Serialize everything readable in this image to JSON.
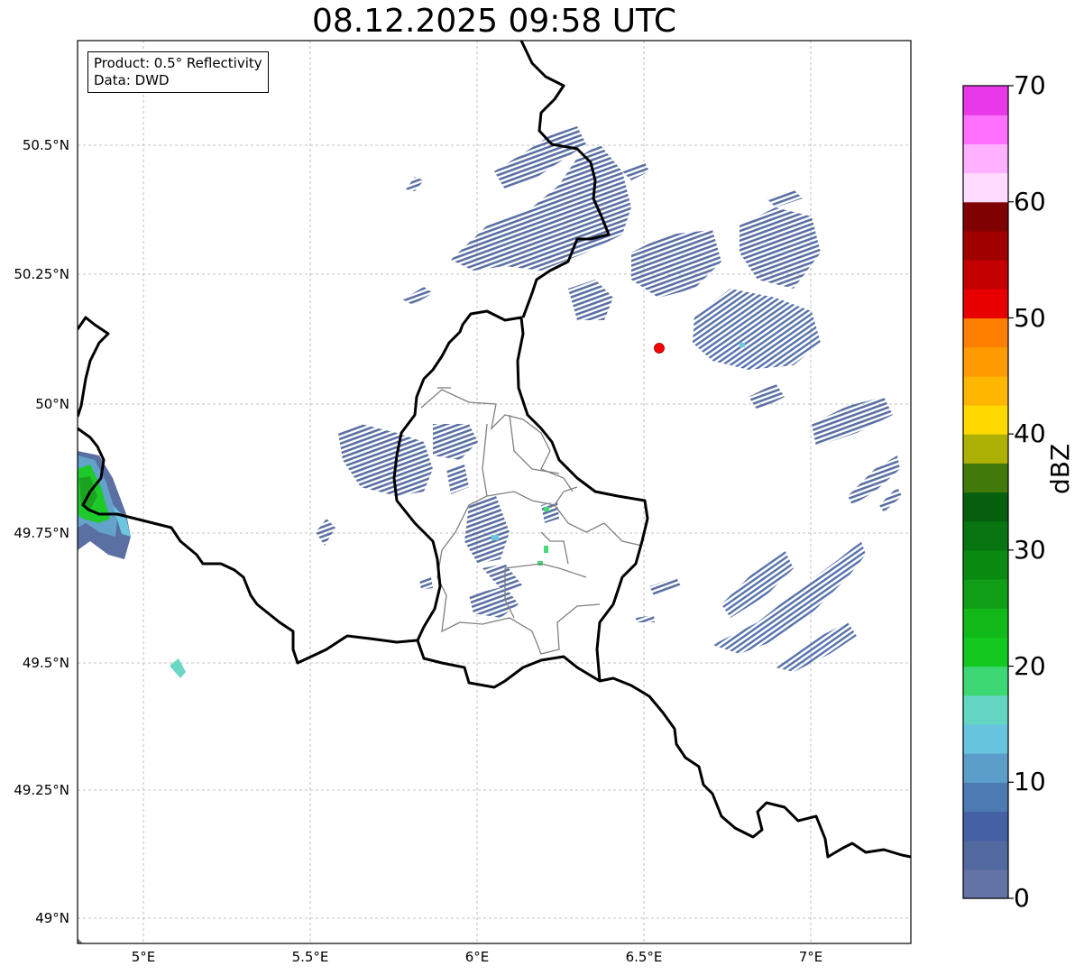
{
  "title": "08.12.2025 09:58 UTC",
  "info": {
    "product": "Product: 0.5° Reflectivity",
    "data": "Data: DWD"
  },
  "map": {
    "lat_labels": [
      "50.5°N",
      "50.25°N",
      "50°N",
      "49.75°N",
      "49.5°N",
      "49.25°N",
      "49°N"
    ],
    "lon_labels": [
      "5°E",
      "5.5°E",
      "6°E",
      "6.5°E",
      "7°E"
    ],
    "lat_values": [
      50.5,
      50.25,
      50.0,
      49.75,
      49.5,
      49.25,
      49.0
    ],
    "lon_values": [
      5.0,
      5.5,
      6.0,
      6.5,
      7.0
    ],
    "extent": {
      "lon_min": 4.8,
      "lon_max": 7.3,
      "lat_min": 48.95,
      "lat_max": 50.7
    },
    "radar_site": {
      "lon": 6.55,
      "lat": 50.11,
      "color": "#ff0000"
    }
  },
  "colorbar": {
    "label": "dBZ",
    "tick_labels": [
      "0",
      "10",
      "20",
      "30",
      "40",
      "50",
      "60",
      "70"
    ],
    "min": 0,
    "max": 70,
    "colors": [
      "#6473a5",
      "#52699f",
      "#4461a6",
      "#4d7ab3",
      "#5a9ec9",
      "#66c4de",
      "#63d6c3",
      "#3dd773",
      "#13c81e",
      "#11b919",
      "#0f9e15",
      "#0b8a12",
      "#077511",
      "#055f0d",
      "#417a0a",
      "#adb103",
      "#ffd800",
      "#ffb600",
      "#ff9a00",
      "#ff7f00",
      "#e80000",
      "#c40000",
      "#a10000",
      "#7f0000",
      "#ffdcff",
      "#ffb0ff",
      "#ff70ff",
      "#e838e8"
    ]
  },
  "colors": {
    "border": "#000000",
    "canton_border": "#808080",
    "echo_main": "#52699f"
  }
}
